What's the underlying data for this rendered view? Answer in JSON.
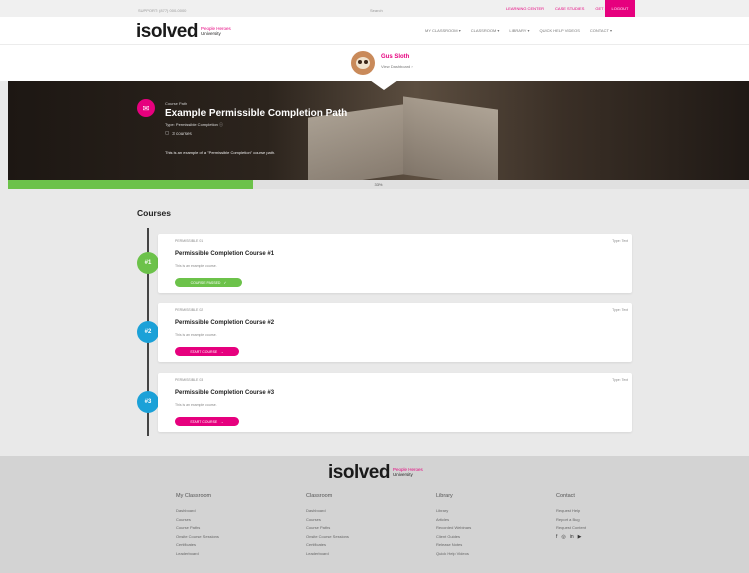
{
  "util": {
    "left": "SUPPORT: (877) 000-0000",
    "mid": "Search",
    "links": [
      "LEARNING CENTER",
      "CASE STUDIES",
      "GET HELP"
    ],
    "cta": "LOGOUT"
  },
  "brand": {
    "word": "isolved",
    "line1": "People Heroes",
    "line2": "University"
  },
  "nav": {
    "items": [
      "MY CLASSROOM ▾",
      "CLASSROOM ▾",
      "LIBRARY ▾",
      "QUICK HELP VIDEOS",
      "CONTACT ▾"
    ]
  },
  "profile": {
    "name": "Gus Sloth",
    "link": "View Dashboard ›"
  },
  "hero": {
    "type_label": "Course Path",
    "title": "Example Permissible Completion Path",
    "meta": "Type: Permissible Completion ⓘ",
    "count": "3 courses",
    "desc": "This is an example of a \"Permissible Completion\" course path."
  },
  "progress": {
    "value": 0.33,
    "label": "33%"
  },
  "courses_title": "Courses",
  "courses": [
    {
      "badge": "#1",
      "code": "PERMISSIBLE 01",
      "type": "Type: Text",
      "title": "Permissible Completion Course #1",
      "desc": "This is an example course.",
      "button": "COURSE PASSED",
      "btn_icon": "✓"
    },
    {
      "badge": "#2",
      "code": "PERMISSIBLE 02",
      "type": "Type: Text",
      "title": "Permissible Completion Course #2",
      "desc": "This is an example course.",
      "button": "START COURSE",
      "btn_icon": "→"
    },
    {
      "badge": "#3",
      "code": "PERMISSIBLE 03",
      "type": "Type: Text",
      "title": "Permissible Completion Course #3",
      "desc": "This is an example course.",
      "button": "START COURSE",
      "btn_icon": "→"
    }
  ],
  "footer": {
    "columns": [
      {
        "heading": "My Classroom",
        "links": [
          "Dashboard",
          "Courses",
          "Course Paths",
          "Onsite Course Sessions",
          "Certificates",
          "Leaderboard"
        ]
      },
      {
        "heading": "Classroom",
        "links": [
          "Dashboard",
          "Courses",
          "Course Paths",
          "Onsite Course Sessions",
          "Certificates",
          "Leaderboard"
        ]
      },
      {
        "heading": "Library",
        "links": [
          "Library",
          "Articles",
          "Recorded Webinars",
          "Client Guides",
          "Release Notes",
          "Quick Help Videos"
        ]
      },
      {
        "heading": "Contact",
        "links": [
          "Request Help",
          "Report a Bug",
          "Request Content"
        ]
      }
    ],
    "social": [
      "f",
      "◎",
      "in",
      "▶"
    ]
  },
  "colors": {
    "brand_pink": "#e6007e",
    "progress_green": "#6cc24a",
    "badge_blue": "#1ba1d8"
  }
}
